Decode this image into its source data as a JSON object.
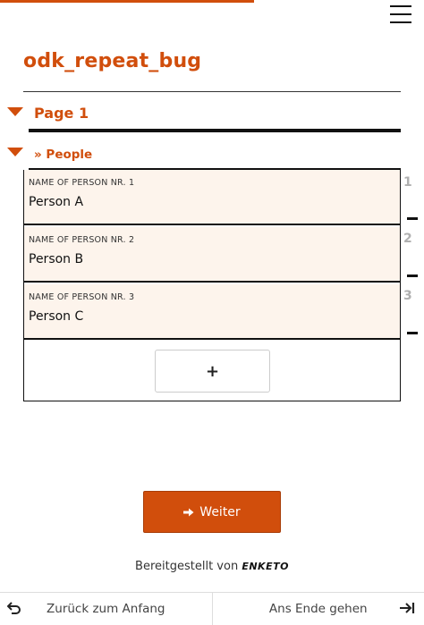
{
  "form": {
    "title": "odk_repeat_bug",
    "progress_percent": 60
  },
  "groups": {
    "page_label": "Page 1",
    "repeat_label": "» People"
  },
  "repeat_items": [
    {
      "number": "1",
      "question_label": "Name of person nr. 1",
      "value": "Person A"
    },
    {
      "number": "2",
      "question_label": "Name of person nr. 2",
      "value": "Person B"
    },
    {
      "number": "3",
      "question_label": "Name of person nr. 3",
      "value": "Person C"
    }
  ],
  "buttons": {
    "add_label": "+",
    "next_label": "Weiter"
  },
  "footer": {
    "powered_by": "Bereitgestellt von",
    "logo_text": "ENKETO",
    "back_to_start": "Zurück zum Anfang",
    "go_to_end": "Ans Ende gehen"
  },
  "icons": {
    "menu": "hamburger-icon",
    "collapse": "caret-down-icon",
    "remove": "minus-icon",
    "next": "arrow-right-icon",
    "back": "undo-arrow-icon",
    "end": "arrow-to-end-icon"
  },
  "colors": {
    "accent": "#d14e0c",
    "item_background": "#fdf4ec",
    "repeat_number": "#b0b0b0"
  }
}
